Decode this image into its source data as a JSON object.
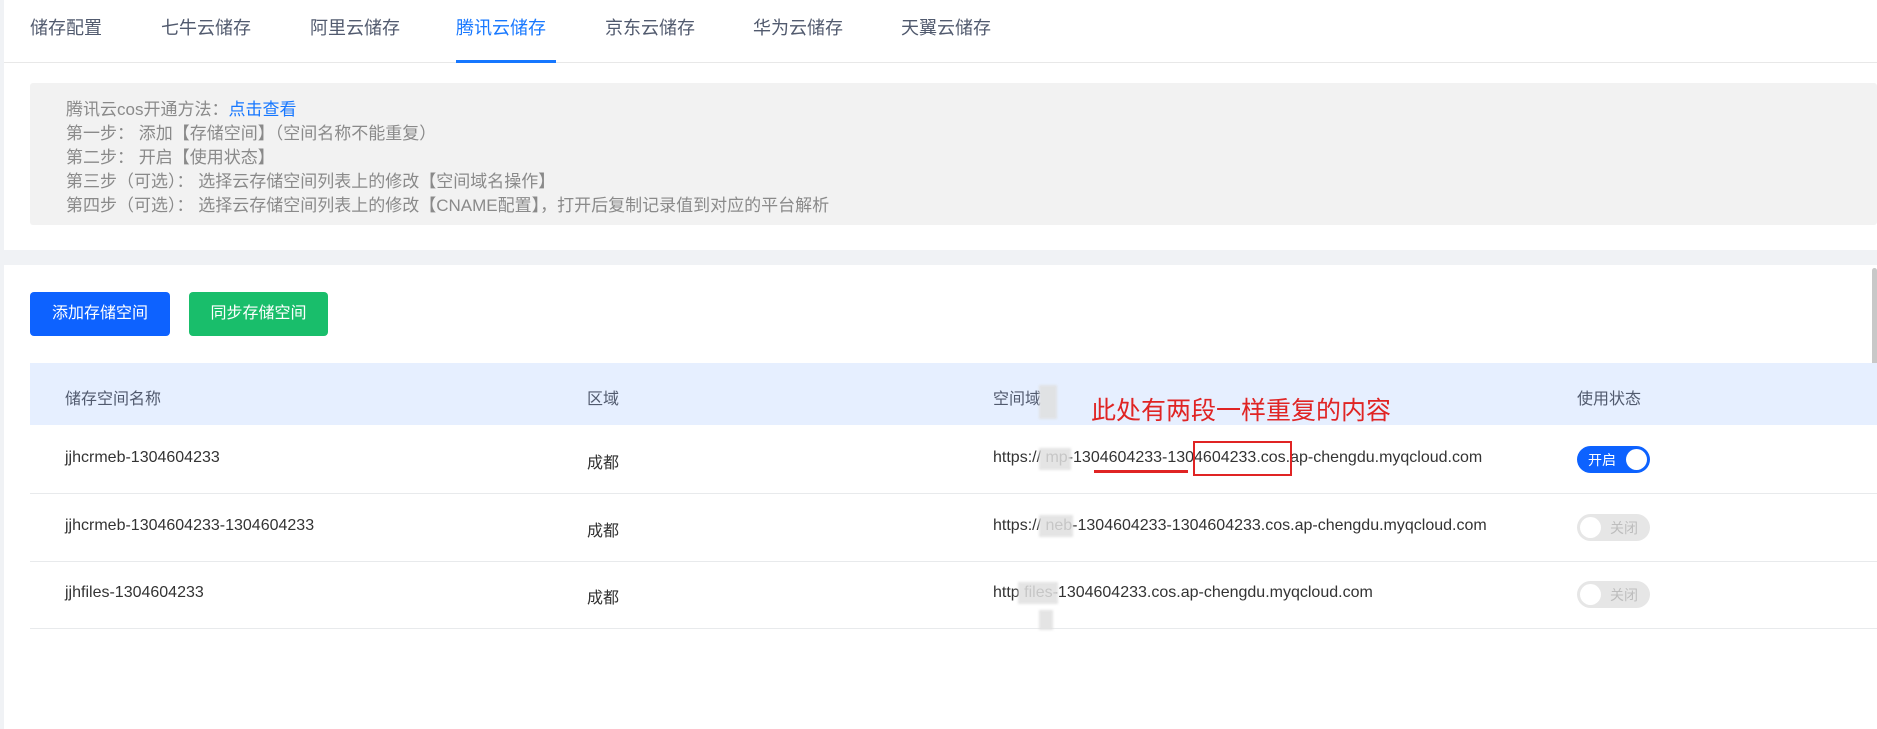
{
  "tabs": [
    {
      "label": "储存配置"
    },
    {
      "label": "七牛云储存"
    },
    {
      "label": "阿里云储存"
    },
    {
      "label": "腾讯云储存",
      "active": true
    },
    {
      "label": "京东云储存"
    },
    {
      "label": "华为云储存"
    },
    {
      "label": "天翼云储存"
    }
  ],
  "notice": {
    "intro": "腾讯云cos开通方法：",
    "link": "点击查看",
    "step1": "第一步：  添加【存储空间】（空间名称不能重复）",
    "step2": "第二步：  开启【使用状态】",
    "step3": "第三步（可选）：  选择云存储空间列表上的修改【空间域名操作】",
    "step4": "第四步（可选）：  选择云存储空间列表上的修改【CNAME配置】，打开后复制记录值到对应的平台解析"
  },
  "buttons": {
    "add": "添加存储空间",
    "sync": "同步存储空间"
  },
  "table": {
    "headers": [
      "储存空间名称",
      "区域",
      "空间域",
      "使用状态"
    ],
    "rows": [
      {
        "name": "jjhcrmeb-1304604233",
        "region": "成都",
        "domain": "https://      mp-1304604233-1304604233.cos.ap-chengdu.myqcloud.com",
        "status": "开启",
        "enabled": true
      },
      {
        "name": "jjhcrmeb-1304604233-1304604233",
        "region": "成都",
        "domain": "https://      neb-1304604233-1304604233.cos.ap-chengdu.myqcloud.com",
        "status": "关闭",
        "enabled": false
      },
      {
        "name": "jjhfiles-1304604233",
        "region": "成都",
        "domain": "http        files-1304604233.cos.ap-chengdu.myqcloud.com",
        "status": "关闭",
        "enabled": false
      }
    ]
  },
  "annotation": {
    "text": "此处有两段一样重复的内容",
    "color": "#e02424"
  },
  "colors": {
    "primary": "#0d62ff",
    "success": "#19be6b",
    "tab_active": "#1677ff"
  }
}
